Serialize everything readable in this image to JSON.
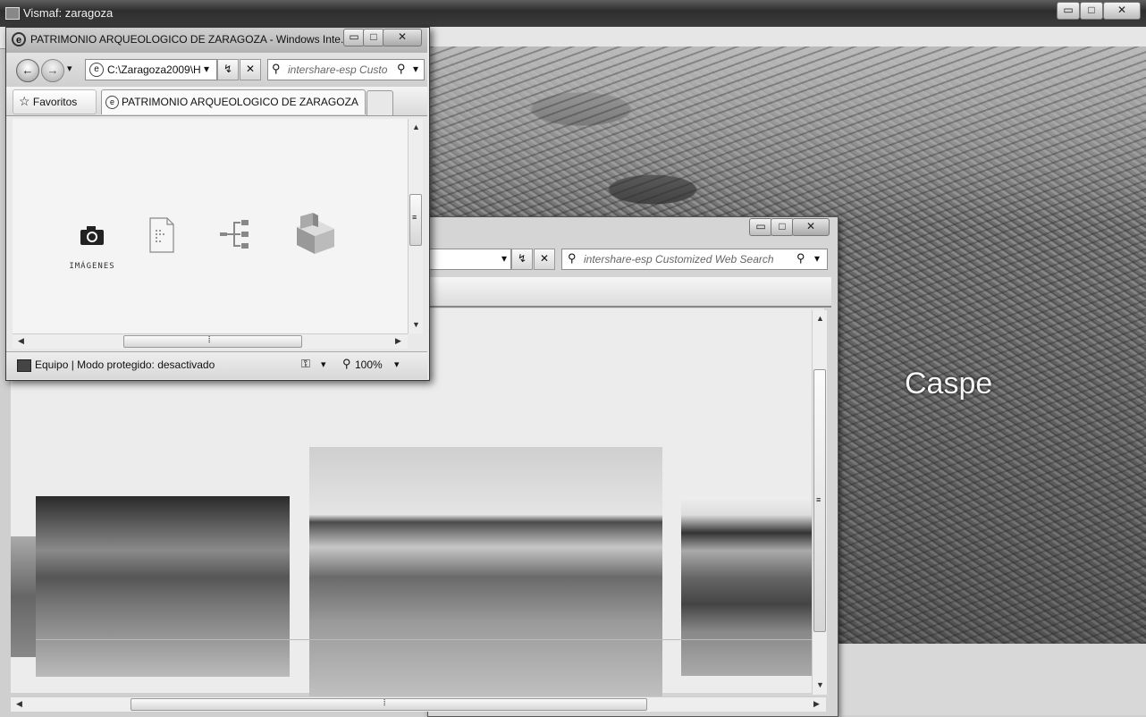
{
  "outer_window": {
    "title": "Vismaf: zaragoza",
    "minimize": "▭",
    "maximize": "□",
    "close": "✕"
  },
  "map": {
    "place_label": "Caspe"
  },
  "front_window": {
    "title": "PATRIMONIO ARQUEOLOGICO DE ZARAGOZA - Windows Inte...",
    "back_glyph": "←",
    "forward_glyph": "→",
    "address": "C:\\Zaragoza2009\\H",
    "search_placeholder": "intershare-esp Custo",
    "favorites_label": "Favoritos",
    "tab_label": "PATRIMONIO ARQUEOLOGICO DE ZARAGOZA",
    "nav_items": [
      {
        "label": "IMÁGENES",
        "icon": "camera-icon"
      },
      {
        "label": "",
        "icon": "document-icon"
      },
      {
        "label": "",
        "icon": "sitemap-icon"
      },
      {
        "label": "",
        "icon": "box-icon"
      }
    ],
    "status_text": "Equipo | Modo protegido: desactivado",
    "zoom": "100%"
  },
  "back_window": {
    "search_placeholder": "intershare-esp Customized Web Search"
  },
  "glyphs": {
    "refresh": "↯",
    "stop": "✕",
    "search": "⚲",
    "dropdown": "▾",
    "grip": "⦙",
    "grip_h": "≡"
  },
  "colors": {
    "map_label": "#f4f4f4",
    "titlebar": "#3c3c3c"
  }
}
